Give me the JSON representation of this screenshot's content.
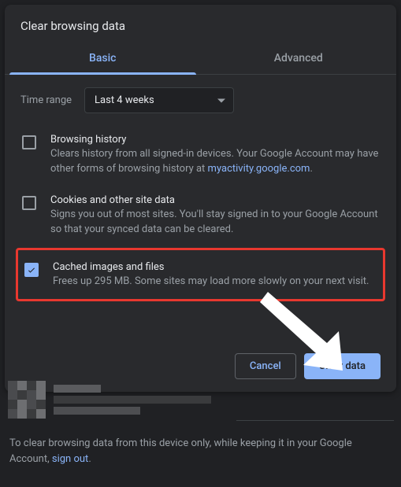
{
  "dialog": {
    "title": "Clear browsing data",
    "tabs": {
      "basic": "Basic",
      "advanced": "Advanced",
      "active": "basic"
    },
    "time_range": {
      "label": "Time range",
      "value": "Last 4 weeks"
    },
    "items": [
      {
        "title": "Browsing history",
        "desc_pre": "Clears history from all signed-in devices. Your Google Account may have other forms of browsing history at ",
        "desc_link": "myactivity.google.com",
        "desc_post": ".",
        "checked": false
      },
      {
        "title": "Cookies and other site data",
        "desc": "Signs you out of most sites. You'll stay signed in to your Google Account so that your synced data can be cleared.",
        "checked": false
      },
      {
        "title": "Cached images and files",
        "desc": "Frees up 295 MB. Some sites may load more slowly on your next visit.",
        "checked": true
      }
    ],
    "buttons": {
      "cancel": "Cancel",
      "confirm": "Clear data"
    }
  },
  "footer": {
    "text_pre": "To clear browsing data from this device only, while keeping it in your Google Account, ",
    "link": "sign out",
    "text_post": "."
  },
  "annotation": {
    "highlight_index": 2
  }
}
